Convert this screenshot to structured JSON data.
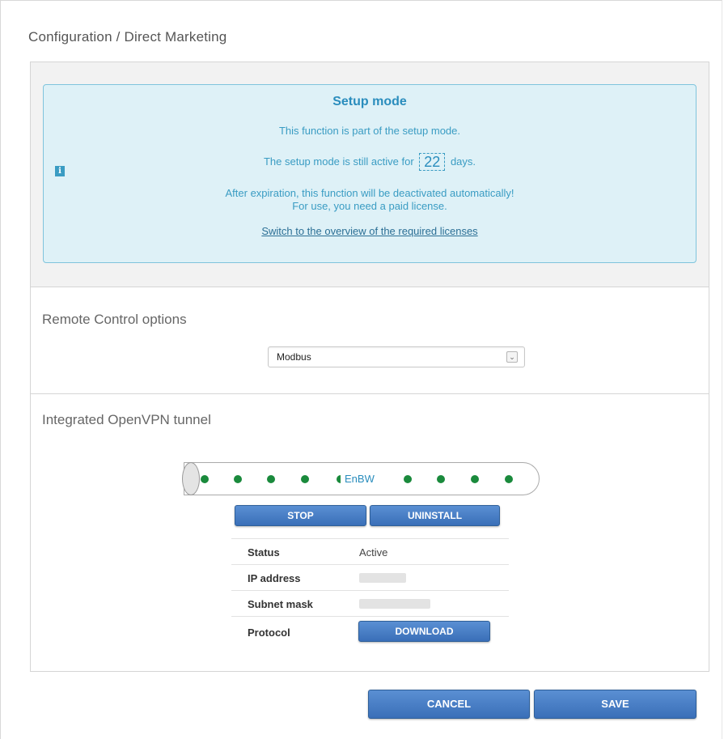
{
  "breadcrumb": "Configuration / Direct Marketing",
  "setup_box": {
    "title": "Setup mode",
    "line1": "This function is part of the setup mode.",
    "line2_prefix": "The setup mode is still active for",
    "days": "22",
    "line2_suffix": "days.",
    "line3a": "After expiration, this function will be deactivated automatically!",
    "line3b": "For use, you need a paid license.",
    "link": "Switch to the overview of the required licenses",
    "info_icon": "i"
  },
  "remote_control": {
    "title": "Remote Control options",
    "selected": "Modbus"
  },
  "vpn": {
    "title": "Integrated OpenVPN tunnel",
    "tunnel_label": "EnBW",
    "stop_label": "STOP",
    "uninstall_label": "UNINSTALL",
    "rows": {
      "status_label": "Status",
      "status_value": "Active",
      "ip_label": "IP address",
      "subnet_label": "Subnet mask",
      "protocol_label": "Protocol",
      "download_label": "DOWNLOAD"
    }
  },
  "footer": {
    "cancel_label": "CANCEL",
    "save_label": "SAVE"
  },
  "colors": {
    "info_bg": "#def1f7",
    "info_text": "#3a9cc3",
    "button": "#3a6fb8",
    "tunnel_dot": "#1a8a3c"
  },
  "icons": {
    "info": "info-icon",
    "select_arrow": "chevron-down-icon"
  }
}
